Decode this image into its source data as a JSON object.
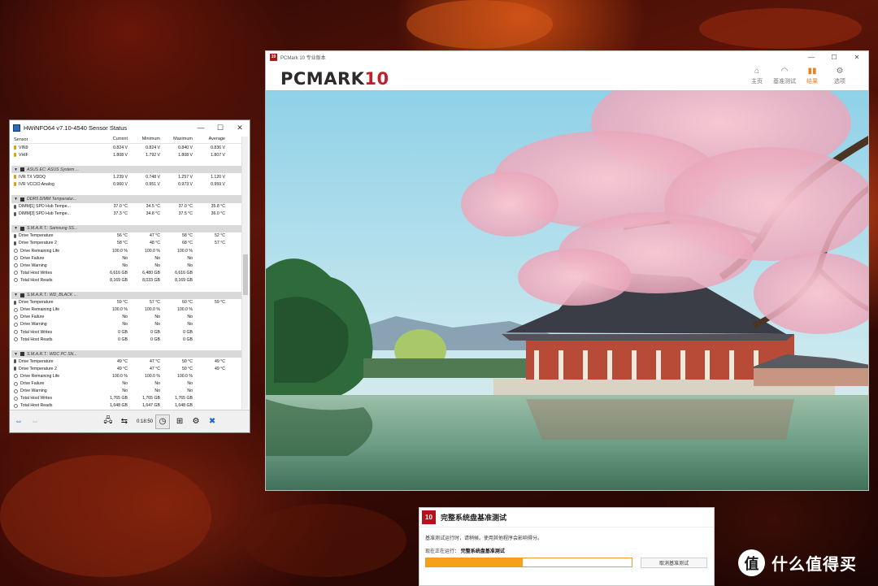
{
  "hwinfo": {
    "title": "HWiNFO64 v7.10-4540 Sensor Status",
    "columns": [
      "Sensor",
      "Current",
      "Minimum",
      "Maximum",
      "Average"
    ],
    "rows": [
      {
        "type": "data",
        "icon": "volt",
        "name": "VIN9",
        "vals": [
          "0.824 V",
          "0.824 V",
          "0.840 V",
          "0.836 V"
        ]
      },
      {
        "type": "data",
        "icon": "volt",
        "name": "VHIF",
        "vals": [
          "1.808 V",
          "1.792 V",
          "1.808 V",
          "1.807 V"
        ]
      },
      {
        "type": "gap"
      },
      {
        "type": "group",
        "name": "ASUS EC: ASUS System ..."
      },
      {
        "type": "data",
        "icon": "volt",
        "name": "IVR TX VDDQ",
        "vals": [
          "1.239 V",
          "0.748 V",
          "1.257 V",
          "1.120 V"
        ]
      },
      {
        "type": "data",
        "icon": "volt",
        "name": "IVR VCCIO Analog",
        "vals": [
          "0.960 V",
          "0.951 V",
          "0.973 V",
          "0.959 V"
        ]
      },
      {
        "type": "gap"
      },
      {
        "type": "group",
        "name": "DDR5 DIMM Temperatur..."
      },
      {
        "type": "data",
        "icon": "temp",
        "name": "DIMM[1] SPD Hub Tempe...",
        "vals": [
          "37.0 °C",
          "34.5 °C",
          "37.0 °C",
          "35.8 °C"
        ]
      },
      {
        "type": "data",
        "icon": "temp",
        "name": "DIMM[3] SPD Hub Tempe...",
        "vals": [
          "37.3 °C",
          "34.8 °C",
          "37.5 °C",
          "36.0 °C"
        ]
      },
      {
        "type": "gap"
      },
      {
        "type": "group",
        "name": "S.M.A.R.T.: Samsung SS..."
      },
      {
        "type": "data",
        "icon": "temp",
        "name": "Drive Temperature",
        "vals": [
          "56 °C",
          "47 °C",
          "58 °C",
          "52 °C"
        ]
      },
      {
        "type": "data",
        "icon": "temp",
        "name": "Drive Temperature 2",
        "vals": [
          "58 °C",
          "48 °C",
          "68 °C",
          "57 °C"
        ]
      },
      {
        "type": "data",
        "icon": "info",
        "name": "Drive Remaining Life",
        "vals": [
          "100.0 %",
          "100.0 %",
          "100.0 %",
          ""
        ]
      },
      {
        "type": "data",
        "icon": "info",
        "name": "Drive Failure",
        "vals": [
          "No",
          "No",
          "No",
          ""
        ]
      },
      {
        "type": "data",
        "icon": "info",
        "name": "Drive Warning",
        "vals": [
          "No",
          "No",
          "No",
          ""
        ]
      },
      {
        "type": "data",
        "icon": "info",
        "name": "Total Host Writes",
        "vals": [
          "6,616 GB",
          "6,480 GB",
          "6,616 GB",
          ""
        ]
      },
      {
        "type": "data",
        "icon": "info",
        "name": "Total Host Reads",
        "vals": [
          "8,169 GB",
          "8,033 GB",
          "8,169 GB",
          ""
        ]
      },
      {
        "type": "gap"
      },
      {
        "type": "group",
        "name": "S.M.A.R.T.: WD_BLACK ..."
      },
      {
        "type": "data",
        "icon": "temp",
        "name": "Drive Temperature",
        "vals": [
          "59 °C",
          "57 °C",
          "60 °C",
          "59 °C"
        ]
      },
      {
        "type": "data",
        "icon": "info",
        "name": "Drive Remaining Life",
        "vals": [
          "100.0 %",
          "100.0 %",
          "100.0 %",
          ""
        ]
      },
      {
        "type": "data",
        "icon": "info",
        "name": "Drive Failure",
        "vals": [
          "No",
          "No",
          "No",
          ""
        ]
      },
      {
        "type": "data",
        "icon": "info",
        "name": "Drive Warning",
        "vals": [
          "No",
          "No",
          "No",
          ""
        ]
      },
      {
        "type": "data",
        "icon": "info",
        "name": "Total Host Writes",
        "vals": [
          "0 GB",
          "0 GB",
          "0 GB",
          ""
        ]
      },
      {
        "type": "data",
        "icon": "info",
        "name": "Total Host Reads",
        "vals": [
          "0 GB",
          "0 GB",
          "0 GB",
          ""
        ]
      },
      {
        "type": "gap"
      },
      {
        "type": "group",
        "name": "S.M.A.R.T.: WDC PC SN..."
      },
      {
        "type": "data",
        "icon": "temp",
        "name": "Drive Temperature",
        "vals": [
          "49 °C",
          "47 °C",
          "50 °C",
          "49 °C"
        ]
      },
      {
        "type": "data",
        "icon": "temp",
        "name": "Drive Temperature 2",
        "vals": [
          "49 °C",
          "47 °C",
          "50 °C",
          "49 °C"
        ]
      },
      {
        "type": "data",
        "icon": "info",
        "name": "Drive Remaining Life",
        "vals": [
          "100.0 %",
          "100.0 %",
          "100.0 %",
          ""
        ]
      },
      {
        "type": "data",
        "icon": "info",
        "name": "Drive Failure",
        "vals": [
          "No",
          "No",
          "No",
          ""
        ]
      },
      {
        "type": "data",
        "icon": "info",
        "name": "Drive Warning",
        "vals": [
          "No",
          "No",
          "No",
          ""
        ]
      },
      {
        "type": "data",
        "icon": "info",
        "name": "Total Host Writes",
        "vals": [
          "1,765 GB",
          "1,765 GB",
          "1,765 GB",
          ""
        ]
      },
      {
        "type": "data",
        "icon": "info",
        "name": "Total Host Reads",
        "vals": [
          "1,648 GB",
          "1,647 GB",
          "1,648 GB",
          ""
        ]
      }
    ],
    "timer": "0:18:50"
  },
  "pcmark": {
    "window_title": "PCMark 10 专业版本",
    "app_icon_label": "10",
    "logo_main": "PCMARK",
    "logo_num": "10",
    "nav": [
      {
        "icon": "home-icon",
        "glyph": "⌂",
        "label": "主页",
        "active": false
      },
      {
        "icon": "gauge-icon",
        "glyph": "◠",
        "label": "基准测试",
        "active": false
      },
      {
        "icon": "bar-chart-icon",
        "glyph": "▮▮",
        "label": "结果",
        "active": true
      },
      {
        "icon": "gear-icon",
        "glyph": "⚙",
        "label": "选项",
        "active": false
      }
    ]
  },
  "dialog": {
    "logo": "10",
    "title": "完整系统盘基准测试",
    "message": "基准测试运行时，请稍候。使用其他程序会影响得分。",
    "running_label": "现在正在运行：",
    "running_value": "完整系统盘基准测试",
    "progress": 0.47,
    "cancel_label": "取消基准测试",
    "colors": {
      "progress": "#f5a21a",
      "brand": "#b0151c"
    }
  },
  "watermark": {
    "badge": "值",
    "text": "什么值得买"
  }
}
